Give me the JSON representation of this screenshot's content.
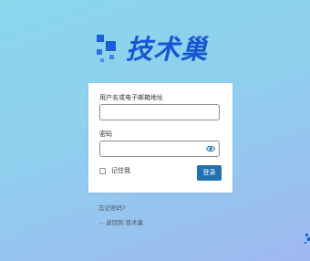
{
  "brand": {
    "logo_text": "技术巢",
    "accent_color": "#1656d6"
  },
  "login_form": {
    "username_label": "用户名或电子邮箱地址",
    "username_value": "",
    "password_label": "密码",
    "password_value": "",
    "show_password_icon": "eye-icon",
    "remember_label": "记住我",
    "remember_checked": false,
    "submit_label": "登录",
    "button_color": "#2271b1"
  },
  "links": {
    "lost_password": "忘记密码?",
    "back_to_site": "← 返回到 技术巢"
  }
}
